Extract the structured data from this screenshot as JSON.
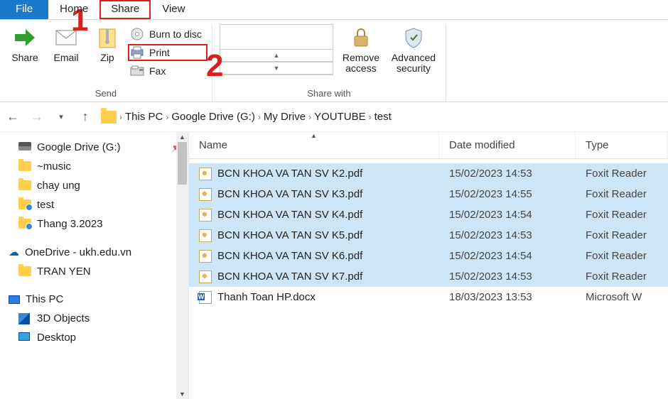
{
  "annotations": {
    "one": "1",
    "two": "2"
  },
  "tabs": {
    "file": "File",
    "home": "Home",
    "share": "Share",
    "view": "View"
  },
  "ribbon": {
    "send_group_label": "Send",
    "share_with_group_label": "Share with",
    "share_btn": "Share",
    "email_btn": "Email",
    "zip_btn": "Zip",
    "burn_btn": "Burn to disc",
    "print_btn": "Print",
    "fax_btn": "Fax",
    "remove_access_btn": "Remove access",
    "advanced_security_btn": "Advanced security"
  },
  "breadcrumbs": [
    "This PC",
    "Google Drive (G:)",
    "My Drive",
    "YOUTUBE",
    "test"
  ],
  "tree": {
    "pinned": [
      {
        "label": "Google Drive (G:)",
        "icon": "drive",
        "pinned": true
      },
      {
        "label": "~music",
        "icon": "folder"
      },
      {
        "label": "chay ung",
        "icon": "folder"
      },
      {
        "label": "test",
        "icon": "folder-shared"
      },
      {
        "label": "Thang 3.2023",
        "icon": "folder-shared"
      }
    ],
    "onedrive_label": "OneDrive - ukh.edu.vn",
    "onedrive_items": [
      {
        "label": "TRAN YEN",
        "icon": "folder"
      }
    ],
    "thispc_label": "This PC",
    "thispc_items": [
      {
        "label": "3D Objects",
        "icon": "cube"
      },
      {
        "label": "Desktop",
        "icon": "desktop"
      }
    ]
  },
  "columns": {
    "name": "Name",
    "date": "Date modified",
    "type": "Type"
  },
  "rows": [
    {
      "name": "BCN KHOA VA TAN SV K2.pdf",
      "date": "15/02/2023 14:53",
      "type": "Foxit Reader",
      "selected": true,
      "icon": "pdf"
    },
    {
      "name": "BCN KHOA VA TAN SV K3.pdf",
      "date": "15/02/2023 14:55",
      "type": "Foxit Reader",
      "selected": true,
      "icon": "pdf"
    },
    {
      "name": "BCN KHOA VA TAN SV K4.pdf",
      "date": "15/02/2023 14:54",
      "type": "Foxit Reader",
      "selected": true,
      "icon": "pdf"
    },
    {
      "name": "BCN KHOA VA TAN SV K5.pdf",
      "date": "15/02/2023 14:53",
      "type": "Foxit Reader",
      "selected": true,
      "icon": "pdf"
    },
    {
      "name": "BCN KHOA VA TAN SV K6.pdf",
      "date": "15/02/2023 14:54",
      "type": "Foxit Reader",
      "selected": true,
      "icon": "pdf"
    },
    {
      "name": "BCN KHOA VA TAN SV K7.pdf",
      "date": "15/02/2023 14:53",
      "type": "Foxit Reader",
      "selected": true,
      "icon": "pdf"
    },
    {
      "name": "Thanh Toan HP.docx",
      "date": "18/03/2023 13:53",
      "type": "Microsoft W",
      "selected": false,
      "icon": "doc"
    }
  ]
}
